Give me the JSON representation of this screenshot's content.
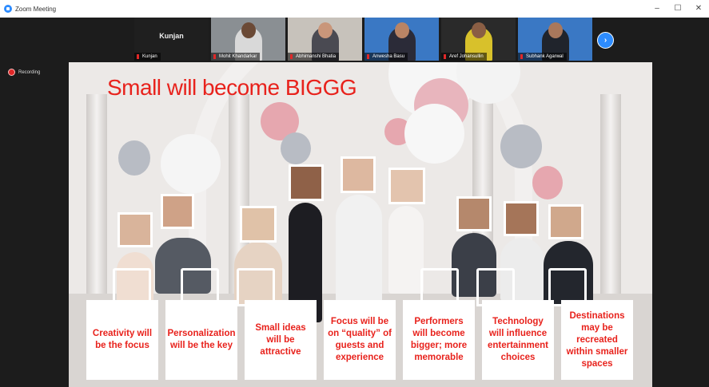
{
  "window": {
    "title": "Zoom Meeting",
    "controls": [
      "–",
      "☐",
      "✕"
    ]
  },
  "recording": {
    "label": "Recording"
  },
  "participants": [
    {
      "display": "Kunjan",
      "name": "Kunjan",
      "video": false
    },
    {
      "name": "Mohit Khandarkar",
      "video": true,
      "bg": "#8a8f93",
      "body": "#d9d9d9",
      "skin": "#6b4a36"
    },
    {
      "name": "Abhimanshi Bhatia",
      "video": true,
      "bg": "#c7c2bb",
      "body": "#4a4a52",
      "skin": "#c9967a"
    },
    {
      "name": "Anwesha Basu",
      "video": true,
      "bg": "#3a78c4",
      "body": "#2b2b38",
      "skin": "#b98465"
    },
    {
      "name": "Aref Johansullin",
      "video": true,
      "bg": "#2a2a2a",
      "body": "#d8c12b",
      "skin": "#8a5e44"
    },
    {
      "name": "Subhank Agarwal",
      "video": true,
      "bg": "#3a78c4",
      "body": "#20242c",
      "skin": "#a9785c"
    }
  ],
  "slide": {
    "title": "Small will become BIGGG",
    "accent": "#e8221c",
    "cards": [
      "Creativity will be the focus",
      "Personalization will be the key",
      "Small ideas will be attractive",
      "Focus will be on “quality” of guests and experience",
      "Performers will become bigger; more memorable",
      "Technology will influence entertainment choices",
      "Destinations may be recreated within smaller spaces"
    ]
  }
}
